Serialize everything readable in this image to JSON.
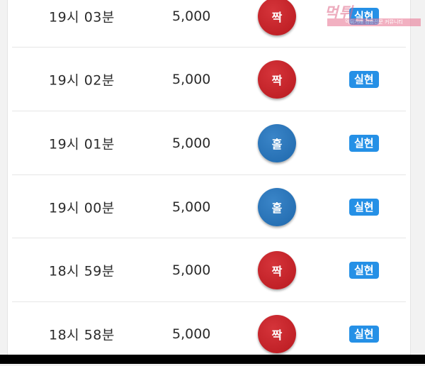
{
  "rows": [
    {
      "time": "19시 03분",
      "amount": "5,000",
      "result": "짝",
      "result_color": "#c2252b",
      "status": "실현"
    },
    {
      "time": "19시 02분",
      "amount": "5,000",
      "result": "짝",
      "result_color": "#c2252b",
      "status": "실현"
    },
    {
      "time": "19시 01분",
      "amount": "5,000",
      "result": "홀",
      "result_color": "#2a73b8",
      "status": "실현"
    },
    {
      "time": "19시 00분",
      "amount": "5,000",
      "result": "홀",
      "result_color": "#2a73b8",
      "status": "실현"
    },
    {
      "time": "18시 59분",
      "amount": "5,000",
      "result": "짝",
      "result_color": "#c2252b",
      "status": "실현"
    },
    {
      "time": "18시 58분",
      "amount": "5,000",
      "result": "짝",
      "result_color": "#c2252b",
      "status": "실현"
    }
  ],
  "watermark": {
    "main": "먹튀",
    "sub": "먹튀거래 검증전문 커뮤니티"
  },
  "colors": {
    "badge": "#2590e6",
    "even_ball": "#c2252b",
    "odd_ball": "#2a73b8"
  }
}
